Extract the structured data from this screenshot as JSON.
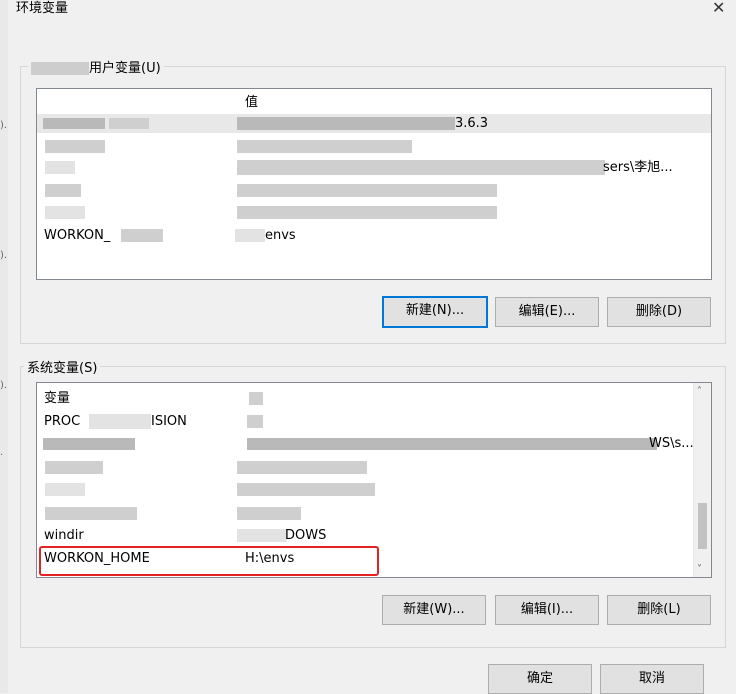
{
  "dialog": {
    "title": "环境变量",
    "close_glyph": "✕"
  },
  "user_vars": {
    "group_label": "用户变量(U)",
    "header": {
      "name": "",
      "value": "值"
    },
    "rows": [
      {
        "name": "",
        "value": "3.6.3"
      },
      {
        "name": "",
        "value": ""
      },
      {
        "name": "",
        "value": "sers\\李旭..."
      },
      {
        "name": "",
        "value": ""
      },
      {
        "name": "",
        "value": ""
      },
      {
        "name": "WORKON_",
        "value": "envs"
      }
    ],
    "buttons": {
      "new": "新建(N)...",
      "edit": "编辑(E)...",
      "delete": "删除(D)"
    }
  },
  "system_vars": {
    "group_label": "系统变量(S)",
    "header": {
      "name": "变量",
      "value": ""
    },
    "rows": [
      {
        "name": "PROC",
        "name_tail": "ISION",
        "value": ""
      },
      {
        "name": "",
        "value": "WS\\s..."
      },
      {
        "name": "",
        "value": ""
      },
      {
        "name": "",
        "value": ""
      },
      {
        "name": "",
        "value": ""
      },
      {
        "name": "windir",
        "value": "DOWS"
      },
      {
        "name": "WORKON_HOME",
        "value": "H:\\envs"
      }
    ],
    "buttons": {
      "new": "新建(W)...",
      "edit": "编辑(I)...",
      "delete": "删除(L)"
    }
  },
  "footer": {
    "ok": "确定",
    "cancel": "取消"
  },
  "icons": {
    "scroll_up": "scroll-up-arrow-icon",
    "scroll_down": "scroll-down-arrow-icon"
  },
  "colors": {
    "highlight": "#e52222",
    "default_button_border": "#0078d7"
  }
}
